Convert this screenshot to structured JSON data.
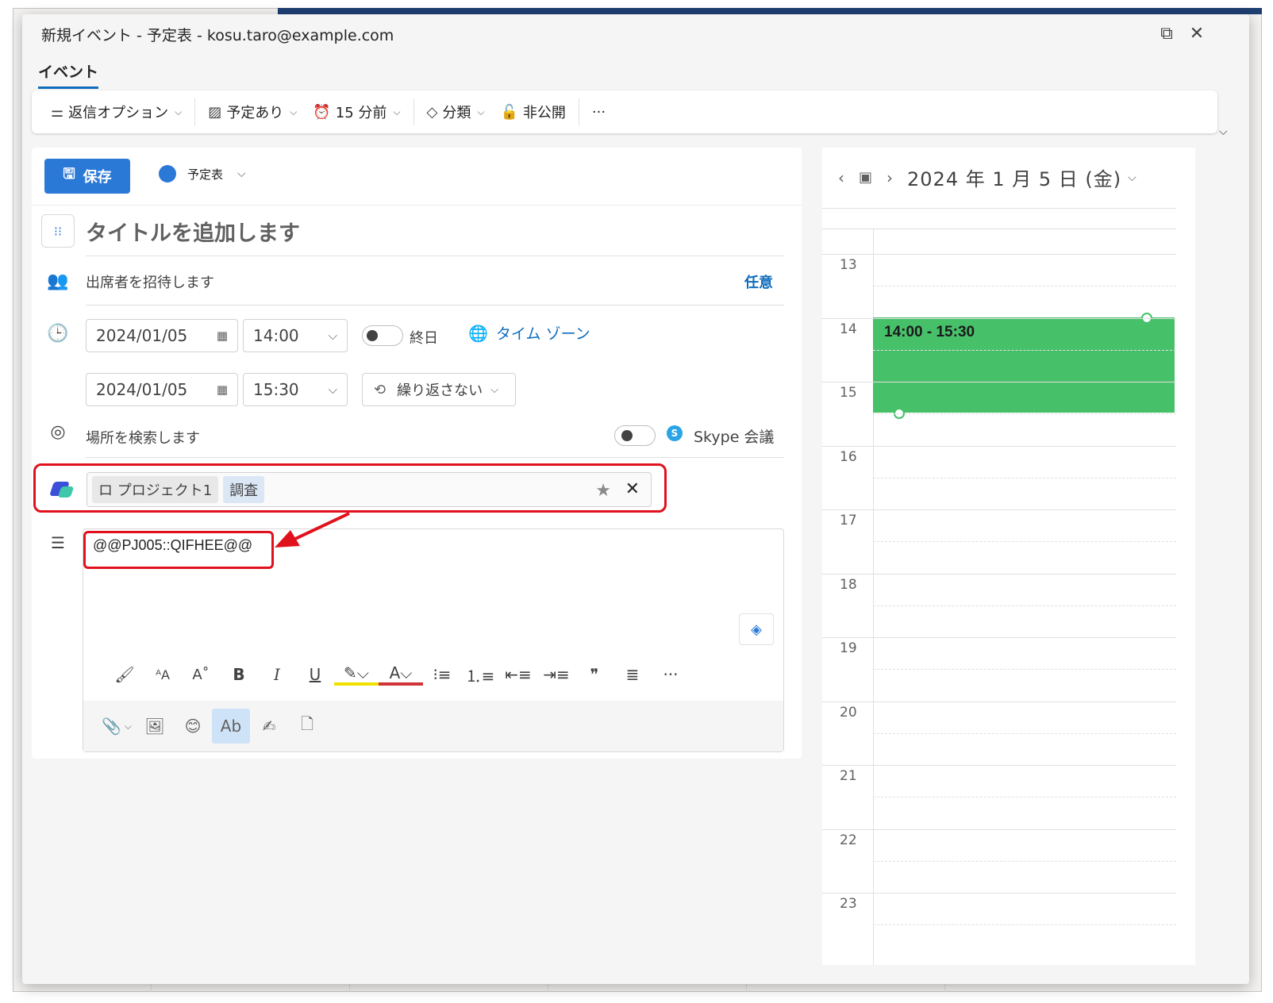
{
  "window": {
    "title": "新規イベント - 予定表 - kosu.taro@example.com",
    "popout_icon": "popout-icon",
    "close_icon": "close-icon"
  },
  "tabs": [
    {
      "label": "イベント",
      "active": true
    }
  ],
  "toolbar": {
    "reply_options": "返信オプション",
    "show_as": "予定あり",
    "reminder": "15 分前",
    "categorize": "分類",
    "private": "非公開",
    "more": "···"
  },
  "form": {
    "save_label": "保存",
    "calendar_name": "予定表",
    "calendar_color": "#2b79d7",
    "title_placeholder": "タイトルを追加します",
    "attendees_placeholder": "出席者を招待します",
    "optional_label": "任意",
    "start_date": "2024/01/05",
    "start_time": "14:00",
    "end_date": "2024/01/05",
    "end_time": "15:30",
    "all_day_label": "終日",
    "timezone_label": "タイム ゾーン",
    "recurrence": "繰り返さない",
    "location_placeholder": "場所を検索します",
    "skype_label": "Skype 会議",
    "project": {
      "chip1": "ロ プロジェクト1",
      "chip2": "調査"
    },
    "body_text": "@@PJ005::QIFHEE@@"
  },
  "calendar": {
    "date_label": "2024 年 1 月 5 日 (金)",
    "hours": [
      "13",
      "14",
      "15",
      "16",
      "17",
      "18",
      "19",
      "20",
      "21",
      "22",
      "23"
    ],
    "event_label": "14:00 - 15:30",
    "event_color": "#47c06a"
  },
  "annotation_color": "#e0111d"
}
